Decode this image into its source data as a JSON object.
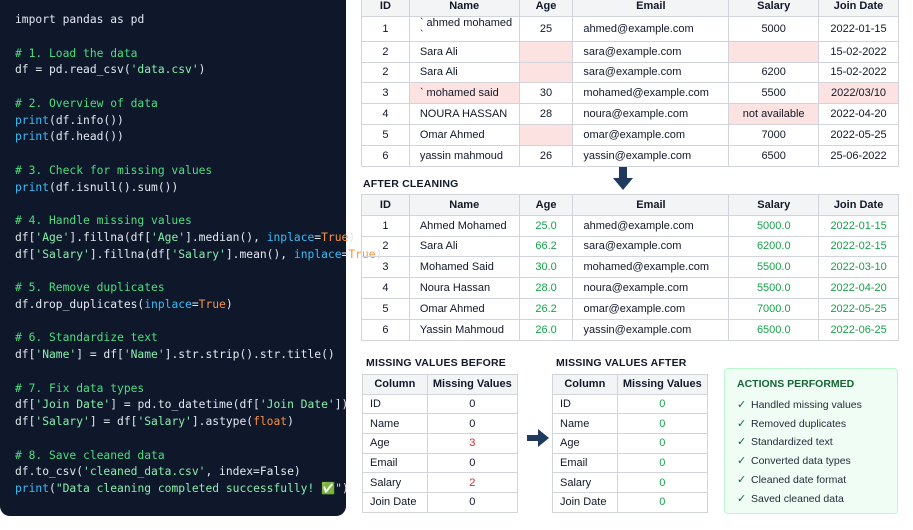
{
  "code": [
    [
      [
        "import",
        "kw"
      ],
      [
        " pandas ",
        "plain"
      ],
      [
        "as",
        "kw"
      ],
      [
        " pd",
        "plain"
      ]
    ],
    [],
    [
      [
        "# 1. Load the data",
        "comment"
      ]
    ],
    [
      [
        "df = pd.read_csv(",
        "plain"
      ],
      [
        "'data.csv'",
        "str"
      ],
      [
        ")",
        "plain"
      ]
    ],
    [],
    [
      [
        "# 2. Overview of data",
        "comment"
      ]
    ],
    [
      [
        "print",
        "kwarg"
      ],
      [
        "(df.info())",
        "plain"
      ]
    ],
    [
      [
        "print",
        "kwarg"
      ],
      [
        "(df.head())",
        "plain"
      ]
    ],
    [],
    [
      [
        "# 3. Check for missing values",
        "comment"
      ]
    ],
    [
      [
        "print",
        "kwarg"
      ],
      [
        "(df.isnull().sum())",
        "plain"
      ]
    ],
    [],
    [
      [
        "# 4. Handle missing values",
        "comment"
      ]
    ],
    [
      [
        "df[",
        "plain"
      ],
      [
        "'Age'",
        "str"
      ],
      [
        "].fillna(df[",
        "plain"
      ],
      [
        "'Age'",
        "str"
      ],
      [
        "].median(), ",
        "plain"
      ],
      [
        "inplace",
        "kwarg"
      ],
      [
        "=",
        "plain"
      ],
      [
        "True",
        "bool"
      ],
      [
        ")",
        "plain"
      ]
    ],
    [
      [
        "df[",
        "plain"
      ],
      [
        "'Salary'",
        "str"
      ],
      [
        "].fillna(df[",
        "plain"
      ],
      [
        "'Salary'",
        "str"
      ],
      [
        "].mean(), ",
        "plain"
      ],
      [
        "inplace",
        "kwarg"
      ],
      [
        "=",
        "plain"
      ],
      [
        "True",
        "bool"
      ],
      [
        ")",
        "plain"
      ]
    ],
    [],
    [
      [
        "# 5. Remove duplicates",
        "comment"
      ]
    ],
    [
      [
        "df.drop_duplicates(",
        "plain"
      ],
      [
        "inplace",
        "kwarg"
      ],
      [
        "=",
        "plain"
      ],
      [
        "True",
        "bool"
      ],
      [
        ")",
        "plain"
      ]
    ],
    [],
    [
      [
        "# 6. Standardize text",
        "comment"
      ]
    ],
    [
      [
        "df[",
        "plain"
      ],
      [
        "'Name'",
        "str"
      ],
      [
        "] = df[",
        "plain"
      ],
      [
        "'Name'",
        "str"
      ],
      [
        "].str.strip().str.title()",
        "plain"
      ]
    ],
    [],
    [
      [
        "# 7. Fix data types",
        "comment"
      ]
    ],
    [
      [
        "df[",
        "plain"
      ],
      [
        "'Join Date'",
        "str"
      ],
      [
        "] = pd.to_datetime(df[",
        "plain"
      ],
      [
        "'Join Date'",
        "str"
      ],
      [
        "])",
        "plain"
      ]
    ],
    [
      [
        "df[",
        "plain"
      ],
      [
        "'Salary'",
        "str"
      ],
      [
        "] = df[",
        "plain"
      ],
      [
        "'Salary'",
        "str"
      ],
      [
        "].astype(",
        "plain"
      ],
      [
        "float",
        "bool"
      ],
      [
        ")",
        "plain"
      ]
    ],
    [],
    [
      [
        "# 8. Save cleaned data",
        "comment"
      ]
    ],
    [
      [
        "df.to_csv(",
        "plain"
      ],
      [
        "'cleaned_data.csv'",
        "str"
      ],
      [
        ", index=False)",
        "plain"
      ]
    ],
    [
      [
        "print",
        "kwarg"
      ],
      [
        "(",
        "plain"
      ],
      [
        "\"Data cleaning completed successfully! ✅\"",
        "str"
      ],
      [
        ")",
        "plain"
      ]
    ]
  ],
  "before_table": {
    "headers": [
      "ID",
      "Name",
      "Age",
      "Email",
      "Salary",
      "Join Date"
    ],
    "rows": [
      [
        "1",
        "` ahmed mohamed `",
        "25",
        "ahmed@example.com",
        "5000",
        "2022-01-15"
      ],
      [
        "2",
        "Sara Ali",
        "",
        "sara@example.com",
        "",
        "15-02-2022"
      ],
      [
        "2",
        "Sara Ali",
        "",
        "sara@example.com",
        "6200",
        "15-02-2022"
      ],
      [
        "3",
        "` mohamed said",
        "30",
        "mohamed@example.com",
        "5500",
        "2022/03/10"
      ],
      [
        "4",
        "NOURA HASSAN",
        "28",
        "noura@example.com",
        "not available",
        "2022-04-20"
      ],
      [
        "5",
        "Omar Ahmed",
        "",
        "omar@example.com",
        "7000",
        "2022-05-25"
      ],
      [
        "6",
        "yassin    mahmoud",
        "26",
        "yassin@example.com",
        "6500",
        "25-06-2022"
      ]
    ],
    "highlight": [
      [],
      [
        2,
        4
      ],
      [
        2
      ],
      [
        1,
        5
      ],
      [
        4
      ],
      [
        2
      ],
      []
    ]
  },
  "after_cleaning_title": "AFTER CLEANING",
  "after_table": {
    "headers": [
      "ID",
      "Name",
      "Age",
      "Email",
      "Salary",
      "Join Date"
    ],
    "rows": [
      [
        "1",
        "Ahmed Mohamed",
        "25.0",
        "ahmed@example.com",
        "5000.0",
        "2022-01-15"
      ],
      [
        "2",
        "Sara Ali",
        "66.2",
        "sara@example.com",
        "6200.0",
        "2022-02-15"
      ],
      [
        "3",
        "Mohamed Said",
        "30.0",
        "mohamed@example.com",
        "5500.0",
        "2022-03-10"
      ],
      [
        "4",
        "Noura Hassan",
        "28.0",
        "noura@example.com",
        "5500.0",
        "2022-04-20"
      ],
      [
        "5",
        "Omar Ahmed",
        "26.2",
        "omar@example.com",
        "7000.0",
        "2022-05-25"
      ],
      [
        "6",
        "Yassin Mahmoud",
        "26.0",
        "yassin@example.com",
        "6500.0",
        "2022-06-25"
      ]
    ]
  },
  "missing_before": {
    "title": "MISSING VALUES BEFORE",
    "headers": [
      "Column",
      "Missing Values"
    ],
    "rows": [
      [
        "ID",
        "0"
      ],
      [
        "Name",
        "0"
      ],
      [
        "Age",
        "3"
      ],
      [
        "Email",
        "0"
      ],
      [
        "Salary",
        "2"
      ],
      [
        "Join Date",
        "0"
      ]
    ]
  },
  "missing_after": {
    "title": "MISSING VALUES AFTER",
    "headers": [
      "Column",
      "Missing Values"
    ],
    "rows": [
      [
        "ID",
        "0"
      ],
      [
        "Name",
        "0"
      ],
      [
        "Age",
        "0"
      ],
      [
        "Email",
        "0"
      ],
      [
        "Salary",
        "0"
      ],
      [
        "Join Date",
        "0"
      ]
    ]
  },
  "actions": {
    "title": "ACTIONS PERFORMED",
    "items": [
      "Handled missing values",
      "Removed duplicates",
      "Standardized text",
      "Converted data types",
      "Cleaned date format",
      "Saved cleaned data"
    ]
  },
  "colors": {
    "code_bg": "#0f172a",
    "comment": "#4ade80",
    "string": "#86efac",
    "keyword_arg": "#38bdf8",
    "boolean": "#fb923c",
    "missing_highlight": "#fde2e2",
    "clean_value": "#16a34a",
    "missing_count": "#dc2626",
    "arrow": "#1e3a5f"
  }
}
